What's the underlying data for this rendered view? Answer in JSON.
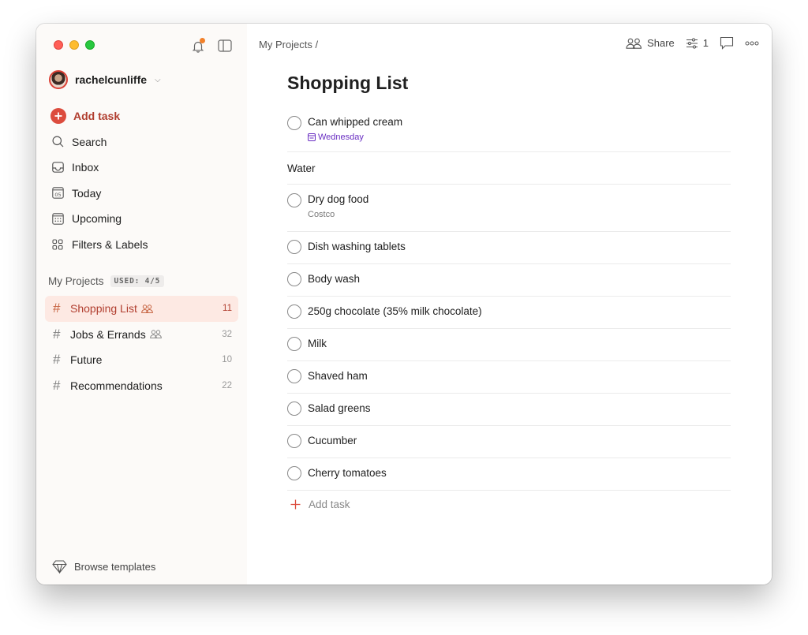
{
  "sidebar": {
    "user": {
      "name": "rachelcunliffe"
    },
    "nav": [
      {
        "label": "Add task",
        "icon": "add-circle-icon"
      },
      {
        "label": "Search",
        "icon": "search-icon"
      },
      {
        "label": "Inbox",
        "icon": "inbox-icon"
      },
      {
        "label": "Today",
        "icon": "calendar-today-icon",
        "icon_text": "05"
      },
      {
        "label": "Upcoming",
        "icon": "calendar-grid-icon"
      },
      {
        "label": "Filters & Labels",
        "icon": "filters-grid-icon"
      }
    ],
    "projects_header": "My Projects",
    "used_badge": "USED: 4/5",
    "projects": [
      {
        "name": "Shopping List",
        "count": "11",
        "shared": true,
        "active": true
      },
      {
        "name": "Jobs & Errands",
        "count": "32",
        "shared": true,
        "active": false
      },
      {
        "name": "Future",
        "count": "10",
        "shared": false,
        "active": false
      },
      {
        "name": "Recommendations",
        "count": "22",
        "shared": false,
        "active": false
      }
    ],
    "browse_templates": "Browse templates"
  },
  "header": {
    "breadcrumb": "My Projects /",
    "share_label": "Share",
    "filter_count": "1"
  },
  "main": {
    "title": "Shopping List",
    "tasks": [
      {
        "content": "Can whipped cream",
        "due": "Wednesday"
      },
      {
        "section": "Water"
      },
      {
        "content": "Dry dog food",
        "description": "Costco"
      },
      {
        "content": "Dish washing tablets"
      },
      {
        "content": "Body wash"
      },
      {
        "content": "250g chocolate (35% milk chocolate)"
      },
      {
        "content": "Milk"
      },
      {
        "content": "Shaved ham"
      },
      {
        "content": "Salad greens"
      },
      {
        "content": "Cucumber"
      },
      {
        "content": "Cherry tomatoes"
      }
    ],
    "add_task_label": "Add task"
  },
  "colors": {
    "accent": "#dc4c3e",
    "active_project_bg": "#fde9e3",
    "due_purple": "#692ec2",
    "notification_dot": "#f2812a"
  }
}
